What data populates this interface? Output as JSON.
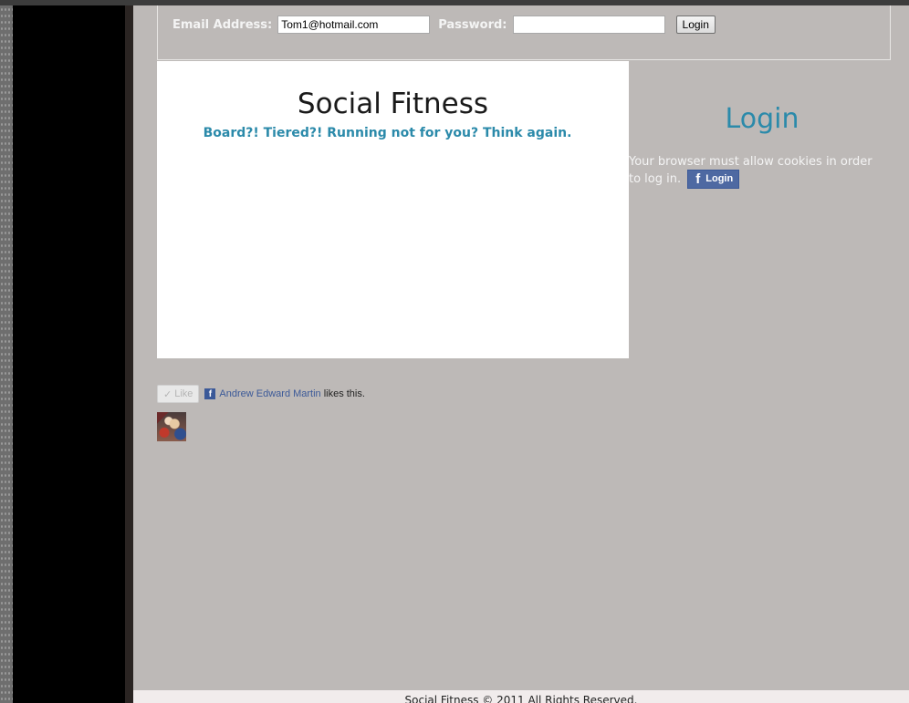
{
  "login_bar": {
    "email_label": "Email Address:",
    "email_value": "Tom1@hotmail.com",
    "password_label": "Password:",
    "password_value": "",
    "login_button": "Login"
  },
  "content": {
    "site_title": "Social Fitness",
    "tagline": "Board?! Tiered?! Running not for you? Think again."
  },
  "sidebar": {
    "title": "Login",
    "cookie_message": "Your browser must allow cookies in order to log in.",
    "fb_login_label": "Login"
  },
  "like_box": {
    "like_label": "Like",
    "liker_name": "Andrew Edward Martin",
    "liker_suffix": "likes this."
  },
  "footer": {
    "text": "Social Fitness © 2011 All Rights Reserved."
  }
}
